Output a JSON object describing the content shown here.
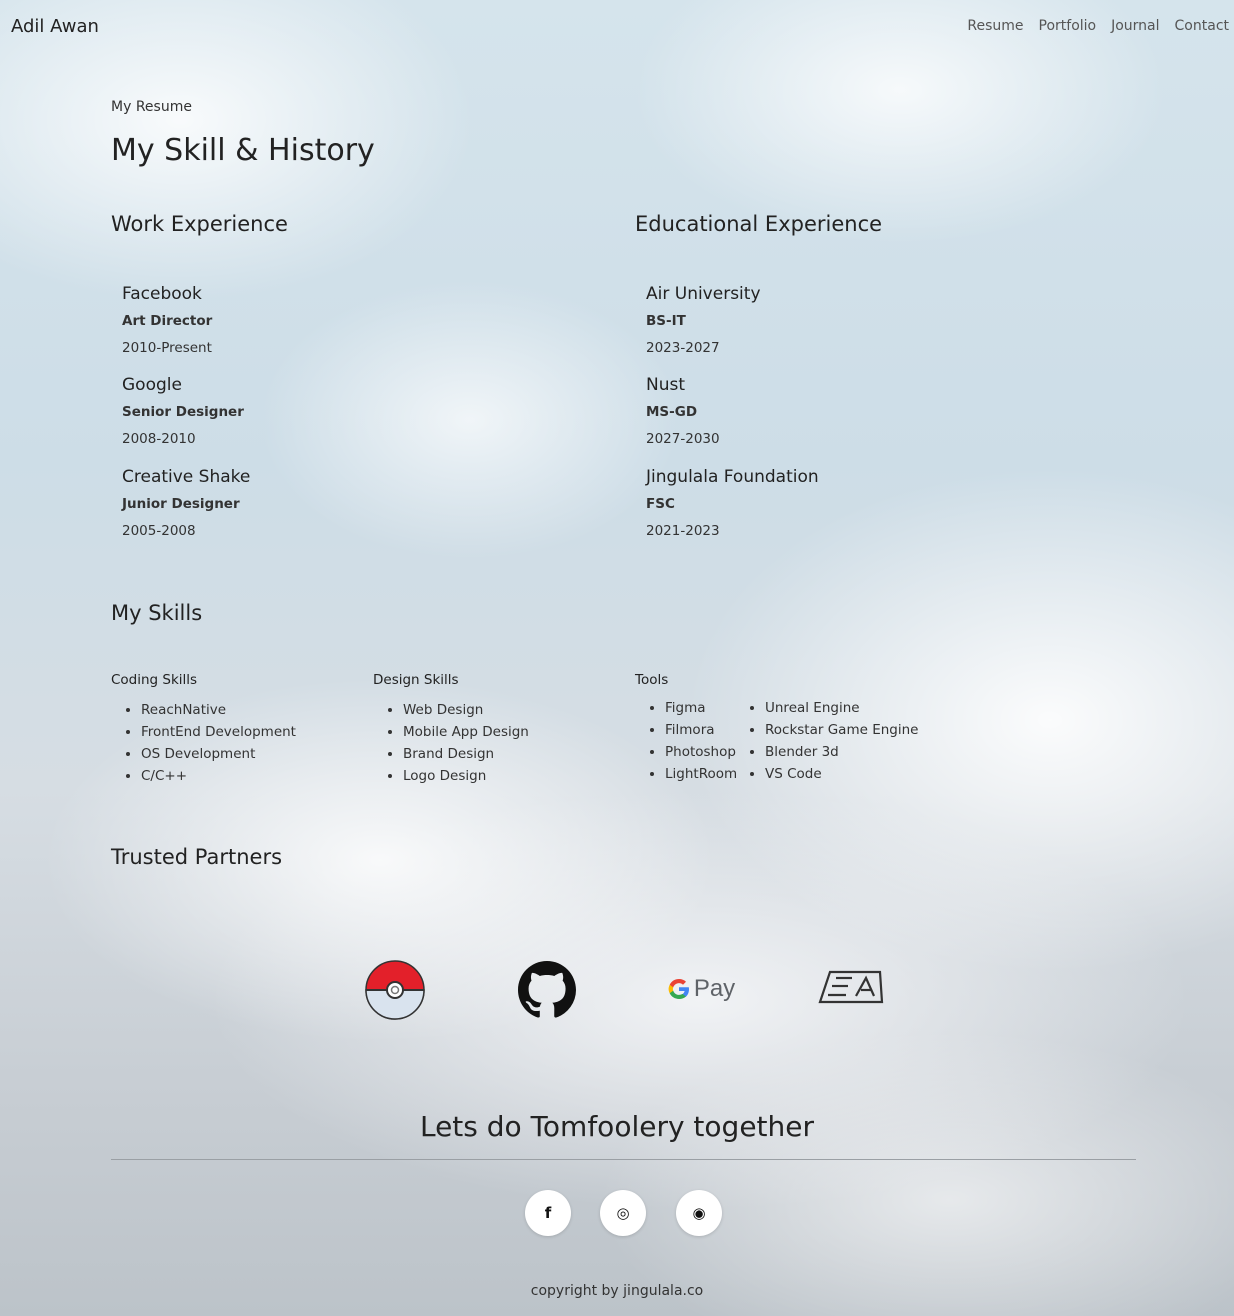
{
  "header": {
    "brand": "Adil Awan",
    "nav": [
      "Resume",
      "Portfolio",
      "Journal",
      "Contact"
    ]
  },
  "intro": {
    "kicker": "My Resume",
    "title": "My Skill & History"
  },
  "work": {
    "title": "Work Experience",
    "items": [
      {
        "org": "Facebook",
        "role": "Art Director",
        "years": "2010-Present"
      },
      {
        "org": "Google",
        "role": "Senior Designer",
        "years": "2008-2010"
      },
      {
        "org": "Creative Shake",
        "role": "Junior Designer",
        "years": "2005-2008"
      }
    ]
  },
  "education": {
    "title": "Educational Experience",
    "items": [
      {
        "org": "Air University",
        "role": "BS-IT",
        "years": "2023-2027"
      },
      {
        "org": "Nust",
        "role": "MS-GD",
        "years": "2027-2030"
      },
      {
        "org": "Jingulala Foundation",
        "role": "FSC",
        "years": "2021-2023"
      }
    ]
  },
  "skills": {
    "title": "My Skills",
    "coding": {
      "title": "Coding Skills",
      "items": [
        "ReachNative",
        "FrontEnd Development",
        "OS Development",
        "C/C++"
      ]
    },
    "design": {
      "title": "Design Skills",
      "items": [
        "Web Design",
        "Mobile App Design",
        "Brand Design",
        "Logo Design"
      ]
    },
    "tools": {
      "title": "Tools",
      "items_a": [
        "Figma",
        "Filmora",
        "Photoshop",
        "LightRoom"
      ],
      "items_b": [
        "Unreal Engine",
        "Rockstar Game Engine",
        "Blender 3d",
        "VS Code"
      ]
    }
  },
  "partners": {
    "title": "Trusted Partners",
    "logos": [
      "pokeball-icon",
      "github-icon",
      "google-pay-logo",
      "ea-logo"
    ],
    "gpay_text": "Pay",
    "ea_text": "EA"
  },
  "footer": {
    "cta": "Lets do Tomfoolery together",
    "social": [
      {
        "icon": "facebook-icon",
        "glyph": "f"
      },
      {
        "icon": "instagram-icon",
        "glyph": "◎"
      },
      {
        "icon": "whatsapp-icon",
        "glyph": "◉"
      }
    ],
    "copyright": "copyright by jingulala.co"
  },
  "colors": {
    "text": "#222222",
    "pokeball_red": "#e3202a",
    "gpay_blue": "#4285f4",
    "gpay_red": "#ea4335",
    "gpay_yellow": "#fbbc05",
    "gpay_green": "#34a853"
  }
}
